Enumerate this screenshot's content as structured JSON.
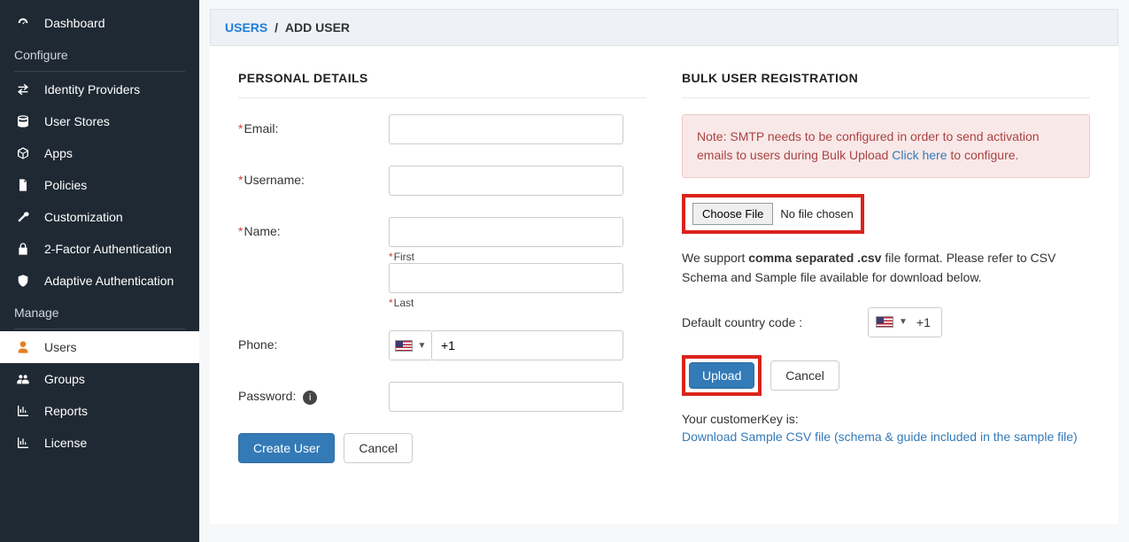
{
  "sidebar": {
    "dashboard": "Dashboard",
    "section_configure": "Configure",
    "identity_providers": "Identity Providers",
    "user_stores": "User Stores",
    "apps": "Apps",
    "policies": "Policies",
    "customization": "Customization",
    "two_factor": "2-Factor Authentication",
    "adaptive_auth": "Adaptive Authentication",
    "section_manage": "Manage",
    "users": "Users",
    "groups": "Groups",
    "reports": "Reports",
    "license": "License"
  },
  "breadcrumb": {
    "users": "USERS",
    "sep": "/",
    "add_user": "ADD USER"
  },
  "left": {
    "title": "PERSONAL DETAILS",
    "email_label": "Email:",
    "username_label": "Username:",
    "name_label": "Name:",
    "first_sub": "First",
    "last_sub": "Last",
    "phone_label": "Phone:",
    "phone_code": "+1",
    "password_label": "Password:",
    "create_btn": "Create User",
    "cancel_btn": "Cancel"
  },
  "right": {
    "title": "BULK USER REGISTRATION",
    "note_prefix": "Note: SMTP needs to be configured in order to send activation emails to users during Bulk Upload ",
    "note_link": "Click here",
    "note_suffix": " to configure.",
    "choose_file_btn": "Choose File",
    "no_file": "No file chosen",
    "support_pre": "We support ",
    "support_strong": "comma separated .csv",
    "support_post": " file format. Please refer to CSV Schema and Sample file available for download below.",
    "default_cc_label": "Default country code :",
    "cc_value": "+1",
    "upload_btn": "Upload",
    "cancel_btn": "Cancel",
    "cust_key_label": "Your customerKey is:",
    "download_link": "Download Sample CSV file (schema & guide included in the sample file)"
  }
}
